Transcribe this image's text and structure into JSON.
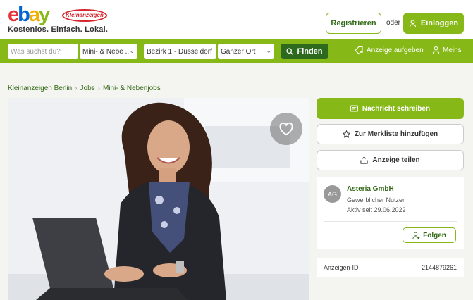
{
  "header": {
    "logo_letters": [
      "e",
      "b",
      "a",
      "y"
    ],
    "logo_badge": "Kleinanzeigen",
    "tagline": "Kostenlos. Einfach. Lokal.",
    "register_label": "Registrieren",
    "or_text": "oder",
    "login_label": "Einloggen"
  },
  "search": {
    "query_placeholder": "Was suchst du?",
    "category_value": "Mini- & Nebe ...",
    "location_value": "Bezirk 1 - Düsseldorf",
    "radius_value": "Ganzer Ort",
    "submit_label": "Finden",
    "post_ad_label": "Anzeige aufgeben",
    "my_label": "Meins"
  },
  "breadcrumb": {
    "items": [
      "Kleinanzeigen Berlin",
      "Jobs",
      "Mini- & Nebenjobs"
    ]
  },
  "actions": {
    "message_label": "Nachricht schreiben",
    "watchlist_label": "Zur Merkliste hinzufügen",
    "share_label": "Anzeige teilen"
  },
  "seller": {
    "initials": "AG",
    "name": "Asteria GmbH",
    "type": "Gewerblicher Nutzer",
    "active_since": "Aktiv seit 29.06.2022",
    "follow_label": "Folgen"
  },
  "ad": {
    "id_label": "Anzeigen-ID",
    "id_value": "2144879261"
  },
  "colors": {
    "brand_green": "#86b817",
    "dark_green": "#326916"
  }
}
